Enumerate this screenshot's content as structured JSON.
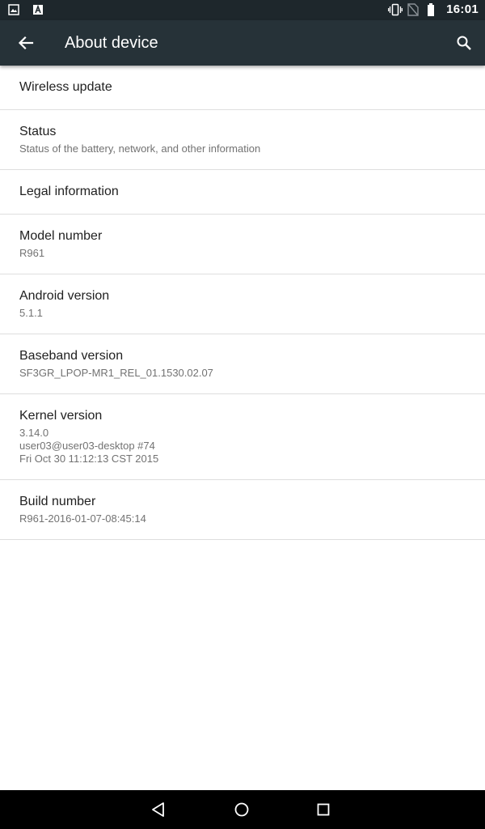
{
  "status_bar": {
    "time": "16:01",
    "left_icons": [
      "image-notification-icon",
      "app-notification-icon"
    ],
    "right_icons": [
      "vibrate-icon",
      "no-sim-icon",
      "battery-icon"
    ]
  },
  "toolbar": {
    "title": "About device",
    "back_icon": "arrow-back-icon",
    "search_icon": "search-icon",
    "background": "#263238"
  },
  "items": [
    {
      "label": "Wireless update",
      "lines": []
    },
    {
      "label": "Status",
      "lines": [
        "Status of the battery, network, and other information"
      ]
    },
    {
      "label": "Legal information",
      "lines": []
    },
    {
      "label": "Model number",
      "lines": [
        "R961"
      ]
    },
    {
      "label": "Android version",
      "lines": [
        "5.1.1"
      ]
    },
    {
      "label": "Baseband version",
      "lines": [
        "SF3GR_LPOP-MR1_REL_01.1530.02.07"
      ]
    },
    {
      "label": "Kernel version",
      "lines": [
        "3.14.0",
        "user03@user03-desktop #74",
        "Fri Oct 30 11:12:13 CST 2015"
      ]
    },
    {
      "label": "Build number",
      "lines": [
        "R961-2016-01-07-08:45:14"
      ]
    }
  ],
  "nav_bar": {
    "icons": [
      "back-triangle-icon",
      "home-circle-icon",
      "recents-square-icon"
    ]
  }
}
